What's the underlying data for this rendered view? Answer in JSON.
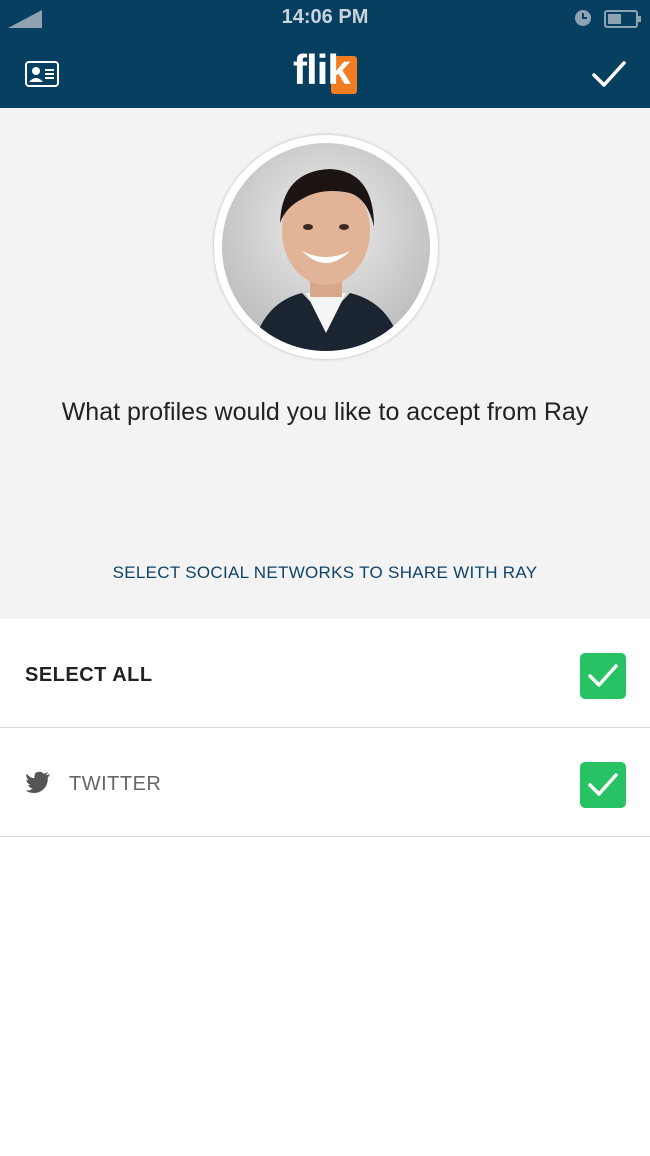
{
  "status_bar": {
    "time": "14:06 PM"
  },
  "header": {
    "logo_text": "flik",
    "logo_color": "#f07d22",
    "bar_color": "#073f61"
  },
  "prompt": {
    "text": "What profiles would you like to accept from Ray"
  },
  "share_caption": "SELECT SOCIAL NETWORKS TO SHARE WITH RAY",
  "options": [
    {
      "label": "SELECT ALL",
      "checked": true
    },
    {
      "label": "TWITTER",
      "icon": "twitter-icon",
      "checked": true
    }
  ],
  "accent_color": "#27c264"
}
